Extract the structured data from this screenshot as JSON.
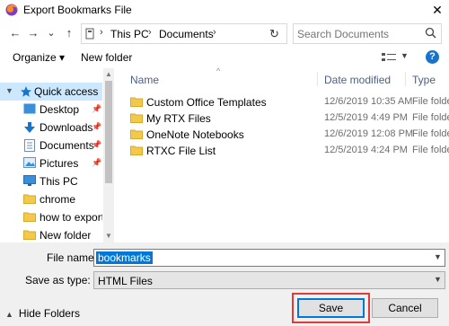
{
  "window": {
    "title": "Export Bookmarks File",
    "close_glyph": "✕",
    "app_icon": "firefox-icon"
  },
  "nav": {
    "back_glyph": "←",
    "forward_glyph": "→",
    "dropdown_glyph": "⌄",
    "up_glyph": "↑",
    "breadcrumb": [
      "This PC",
      "Documents"
    ],
    "separator": "›",
    "refresh_glyph": "↻",
    "search_placeholder": "Search Documents"
  },
  "toolbar": {
    "organize_label": "Organize ▾",
    "new_folder_label": "New folder",
    "help_label": "?"
  },
  "sidebar": {
    "items": [
      {
        "label": "Quick access",
        "icon": "star-icon",
        "pinned": false
      },
      {
        "label": "Desktop",
        "icon": "desktop-folder-icon",
        "pinned": true
      },
      {
        "label": "Downloads",
        "icon": "download-arrow-icon",
        "pinned": true
      },
      {
        "label": "Documents",
        "icon": "documents-icon",
        "pinned": true
      },
      {
        "label": "Pictures",
        "icon": "pictures-icon",
        "pinned": true
      },
      {
        "label": "This PC",
        "icon": "monitor-icon",
        "pinned": false
      },
      {
        "label": "chrome",
        "icon": "folder-icon",
        "pinned": false
      },
      {
        "label": "how to export bo",
        "icon": "folder-icon",
        "pinned": false
      },
      {
        "label": "New folder",
        "icon": "folder-icon",
        "pinned": false
      }
    ]
  },
  "files": {
    "columns": {
      "name": "Name",
      "date": "Date modified",
      "type": "Type"
    },
    "rows": [
      {
        "name": "Custom Office Templates",
        "date": "12/6/2019 10:35 AM",
        "type": "File folder"
      },
      {
        "name": "My RTX Files",
        "date": "12/5/2019 4:49 PM",
        "type": "File folder"
      },
      {
        "name": "OneNote Notebooks",
        "date": "12/6/2019 12:08 PM",
        "type": "File folder"
      },
      {
        "name": "RTXC File List",
        "date": "12/5/2019 4:24 PM",
        "type": "File folder"
      }
    ]
  },
  "form": {
    "file_name_label": "File name:",
    "file_name_value": "bookmarks",
    "save_type_label": "Save as type:",
    "save_type_value": "HTML Files"
  },
  "footer": {
    "hide_folders_label": "Hide Folders",
    "save_label": "Save",
    "cancel_label": "Cancel"
  },
  "colors": {
    "accent": "#0078d7",
    "folder": "#e8b63a",
    "highlight_outline": "#e03a3a",
    "selection": "#cce8ff"
  }
}
